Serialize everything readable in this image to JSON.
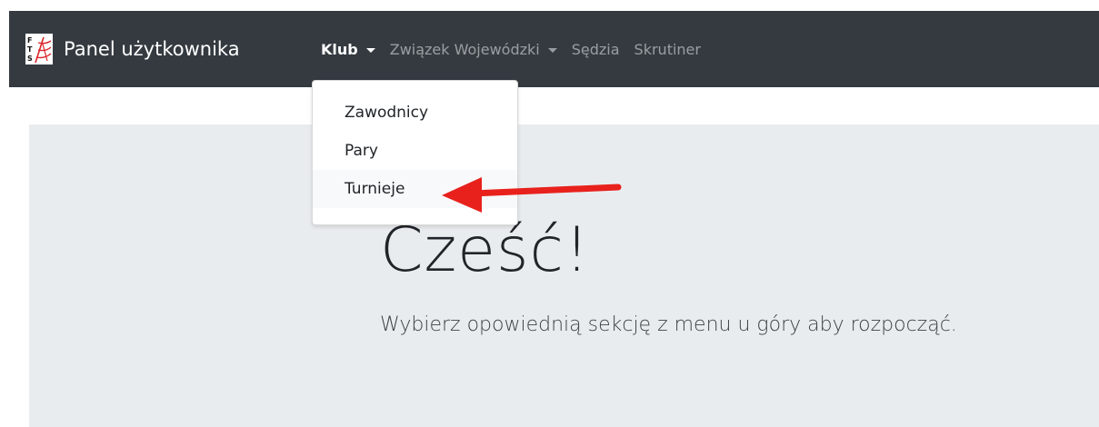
{
  "navbar": {
    "brand": {
      "logo_icon": "fts-logo-icon",
      "title": "Panel użytkownika"
    },
    "items": [
      {
        "label": "Klub",
        "active": true,
        "has_dropdown": true
      },
      {
        "label": "Związek Wojewódzki",
        "active": false,
        "has_dropdown": true
      },
      {
        "label": "Sędzia",
        "active": false,
        "has_dropdown": false
      },
      {
        "label": "Skrutiner",
        "active": false,
        "has_dropdown": false
      }
    ]
  },
  "dropdown": {
    "open_for": "Klub",
    "items": [
      {
        "label": "Zawodnicy"
      },
      {
        "label": "Pary"
      },
      {
        "label": "Turnieje",
        "highlighted": true
      }
    ]
  },
  "annotation": {
    "type": "arrow",
    "color": "#e8211c",
    "points_to": "Turnieje"
  },
  "jumbotron": {
    "heading": "Cześć!",
    "lead": "Wybierz opowiednią sekcję z menu u góry aby rozpocząć."
  },
  "colors": {
    "navbar_bg": "#343a40",
    "jumbotron_bg": "#e9ecef",
    "nav_inactive": "rgba(255,255,255,0.5)",
    "nav_active": "#ffffff"
  }
}
